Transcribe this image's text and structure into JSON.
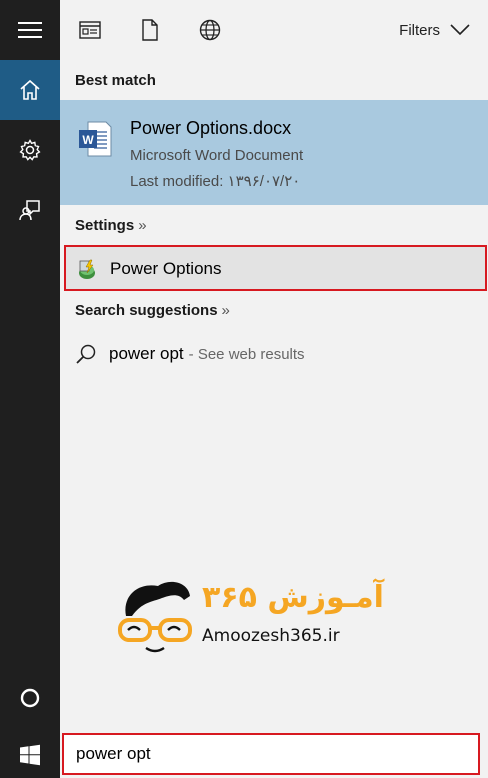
{
  "rail": {
    "menu_icon": "hamburger-icon",
    "items": [
      {
        "icon": "home-icon",
        "active": true
      },
      {
        "icon": "gear-icon"
      },
      {
        "icon": "feedback-icon"
      }
    ],
    "cortana_icon": "cortana-circle-icon",
    "start_icon": "windows-logo-icon"
  },
  "topbar": {
    "filter_icons": [
      "apps-icon",
      "document-icon",
      "globe-icon"
    ],
    "filters_label": "Filters"
  },
  "best_match": {
    "heading": "Best match",
    "title": "Power Options.docx",
    "subtitle": "Microsoft Word Document",
    "modified": "Last modified: ۱۳۹۶/۰۷/۲۰"
  },
  "settings": {
    "heading": "Settings",
    "chevron": "»",
    "item_label": "Power Options"
  },
  "suggestions": {
    "heading": "Search suggestions",
    "chevron": "»",
    "query": "power opt",
    "suffix": "- See web results"
  },
  "watermark": {
    "persian": "آمـوزش ۳۶۵",
    "english": "Amoozesh365.ir"
  },
  "search": {
    "value": "power opt"
  },
  "colors": {
    "accent": "#1f5c86",
    "selected": "#a9c9df",
    "highlight_border": "#d71920",
    "rail": "#1f1f1f",
    "logo": "#f5a623"
  }
}
